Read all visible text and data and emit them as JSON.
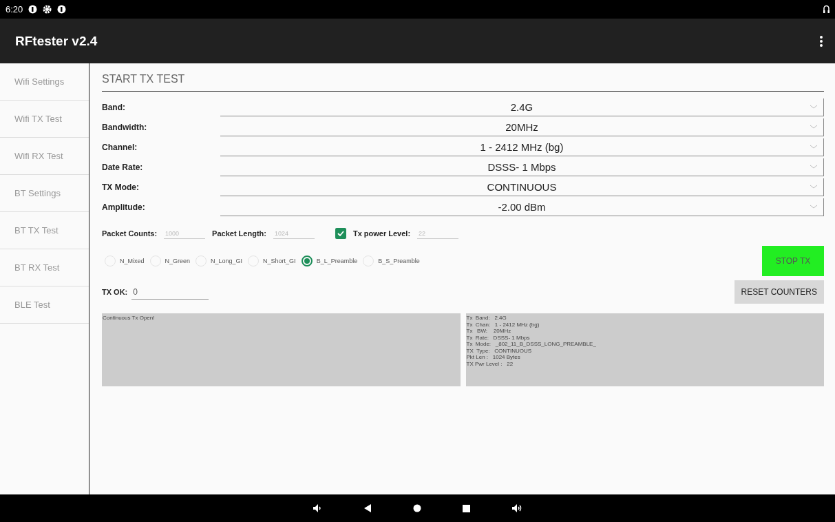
{
  "status_bar": {
    "time": "6:20"
  },
  "app_bar": {
    "title": "RFtester v2.4"
  },
  "sidebar": {
    "items": [
      {
        "label": "Wifi Settings",
        "selected": false
      },
      {
        "label": "Wifi TX Test",
        "selected": false
      },
      {
        "label": "Wifi RX Test",
        "selected": false
      },
      {
        "label": "BT Settings",
        "selected": false
      },
      {
        "label": "BT TX Test",
        "selected": false
      },
      {
        "label": "BT RX Test",
        "selected": false
      },
      {
        "label": "BLE Test",
        "selected": false
      }
    ]
  },
  "section_title": "START TX TEST",
  "settings": [
    {
      "label": "Band:",
      "value": "2.4G"
    },
    {
      "label": "Bandwidth:",
      "value": "20MHz"
    },
    {
      "label": "Channel:",
      "value": "1 - 2412 MHz (bg)"
    },
    {
      "label": "Date Rate:",
      "value": "DSSS- 1 Mbps"
    },
    {
      "label": "TX Mode:",
      "value": "CONTINUOUS"
    },
    {
      "label": "Amplitude:",
      "value": "-2.00 dBm"
    }
  ],
  "packet_counts": {
    "label": "Packet Counts:",
    "placeholder": "1000"
  },
  "packet_length": {
    "label": "Packet Length:",
    "placeholder": "1024"
  },
  "tx_power": {
    "label": "Tx power Level:",
    "checked": true,
    "placeholder": "22"
  },
  "modes": [
    {
      "label": "N_Mixed",
      "selected": false
    },
    {
      "label": "N_Green",
      "selected": false
    },
    {
      "label": "N_Long_GI",
      "selected": false
    },
    {
      "label": "N_Short_GI",
      "selected": false
    },
    {
      "label": "B_L_Preamble",
      "selected": true
    },
    {
      "label": "B_S_Preamble",
      "selected": false
    }
  ],
  "stop_button": "STOP TX",
  "tx_ok": {
    "label": "TX OK:",
    "value": "0"
  },
  "reset_button": "RESET COUNTERS",
  "log": "Continuous Tx Open!",
  "info_lines": [
    "Tx  Band:   2.4G",
    "Tx  Chan:   1 - 2412 MHz (bg)",
    "Tx   BW:    20MHz",
    "Tx  Rate:   DSSS- 1 Mbps",
    "Tx  Mode:   _802_11_B_DSSS_LONG_PREAMBLE_",
    "TX  Type:   CONTINUOUS",
    "Pkt Len :   1024 Bytes",
    "TX Pwr Level :   22"
  ]
}
